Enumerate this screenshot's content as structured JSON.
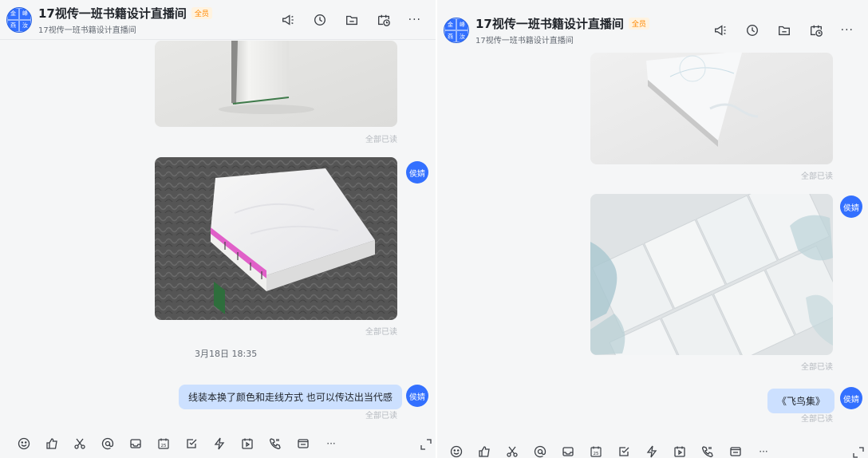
{
  "group": {
    "title": "17视传一班书籍设计直播间",
    "subtitle": "17视传一班书籍设计直播间",
    "badge": "全员",
    "avatar_chars": [
      "金",
      "峰",
      "燕",
      "汝"
    ]
  },
  "left": {
    "messages": {
      "read_status_1": "全部已读",
      "read_status_2": "全部已读",
      "timestamp": "3月18日 18:35",
      "text_message": "线装本换了颜色和走线方式 也可以传达出当代感",
      "read_status_3": "全部已读",
      "sender": "侯婧"
    }
  },
  "right": {
    "messages": {
      "read_status_1": "全部已读",
      "read_status_2": "全部已读",
      "text_message": "《飞鸟集》",
      "read_status_3": "全部已读",
      "sender": "侯婧"
    }
  },
  "header_icons": [
    "megaphone-icon",
    "clock-icon",
    "folder-icon",
    "calendar-clock-icon",
    "more-icon"
  ],
  "toolbar_icons": [
    "emoji-icon",
    "thumbs-up-icon",
    "scissors-icon",
    "at-icon",
    "inbox-icon",
    "calendar-25-icon",
    "checkbox-icon",
    "lightning-icon",
    "play-icon",
    "call-icon",
    "mail-icon",
    "more-icon"
  ],
  "more_label": "···",
  "colors": {
    "accent": "#3370ff",
    "bubble": "#cce0ff",
    "badge": "#ff8800"
  }
}
